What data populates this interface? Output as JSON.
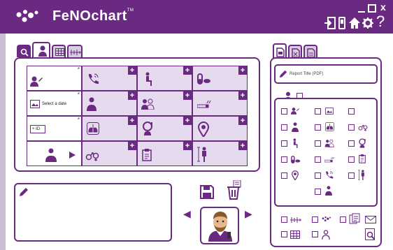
{
  "app": {
    "name": "FeNOchart",
    "trademark": "TM"
  },
  "colors": {
    "brand": "#6a2a82",
    "cell_fill": "#e6dbee"
  },
  "header_icons": [
    "logout-icon",
    "mobile-icon",
    "home-icon",
    "settings-icon",
    "help-icon",
    "minimize-icon",
    "maximize-icon",
    "close-icon"
  ],
  "header": {
    "help_symbol": "?",
    "close_symbol": "x"
  },
  "left_tabs": [
    "search-icon",
    "person-icon",
    "table-icon",
    "timeline-icon"
  ],
  "grid": {
    "date_label": "Select a date",
    "id_label": "+ ID",
    "rows": 4,
    "cols": 4
  },
  "report": {
    "title_placeholder": "Report Title (PDF)"
  },
  "right_tabs": [
    "pdf-icon",
    "excel-icon",
    "document-icon"
  ],
  "nav": {
    "prev": "◀",
    "next": "▶"
  }
}
